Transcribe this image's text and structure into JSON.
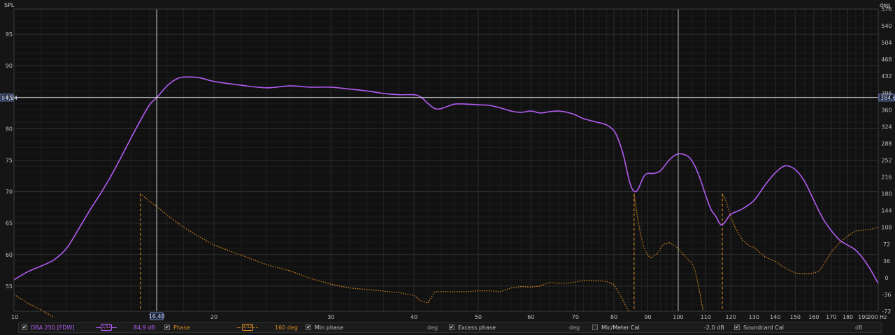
{
  "chart_data": {
    "type": "line",
    "x_scale": "log",
    "xlim": [
      10,
      200
    ],
    "ylim": [
      51,
      99
    ],
    "y2lim": [
      -72,
      576
    ],
    "ylabel": "SPL",
    "y2label": "deg",
    "x_unit_label": "Hz",
    "x_ticks": [
      {
        "value": 10,
        "label": "10"
      },
      {
        "value": 20,
        "label": "20"
      },
      {
        "value": 30,
        "label": "30"
      },
      {
        "value": 40,
        "label": "40"
      },
      {
        "value": 50,
        "label": "50"
      },
      {
        "value": 60,
        "label": "60"
      },
      {
        "value": 70,
        "label": "70"
      },
      {
        "value": 80,
        "label": "80"
      },
      {
        "value": 90,
        "label": "90"
      },
      {
        "value": 100,
        "label": "100"
      },
      {
        "value": 110,
        "label": "110"
      },
      {
        "value": 120,
        "label": "120"
      },
      {
        "value": 130,
        "label": "130"
      },
      {
        "value": 140,
        "label": "140"
      },
      {
        "value": 150,
        "label": "150"
      },
      {
        "value": 160,
        "label": "160"
      },
      {
        "value": 170,
        "label": "170"
      },
      {
        "value": 180,
        "label": "180"
      },
      {
        "value": 190,
        "label": "190"
      },
      {
        "value": 200,
        "label": "200"
      }
    ],
    "y_ticks": [
      "55",
      "60",
      "65",
      "70",
      "75",
      "80",
      "85",
      "90",
      "95"
    ],
    "y2_ticks": [
      "-72",
      "-36",
      "0",
      "36",
      "72",
      "108",
      "144",
      "180",
      "216",
      "252",
      "288",
      "324",
      "360",
      "396",
      "432",
      "468",
      "504",
      "540",
      "576"
    ],
    "grid": true,
    "cursor": {
      "x_label": "16,40",
      "y_label": "84,94",
      "y2_label": "384,6",
      "x_value": 16.4,
      "y_value": 84.94
    },
    "marker_x": 100,
    "spl_series": {
      "name": "DBA 250 [FDW]",
      "color": "#b25cf2",
      "points": [
        [
          10,
          56.0
        ],
        [
          10.5,
          57.3
        ],
        [
          11,
          58.2
        ],
        [
          11.5,
          59.2
        ],
        [
          12,
          61.0
        ],
        [
          12.5,
          64.0
        ],
        [
          13,
          67.0
        ],
        [
          13.5,
          69.7
        ],
        [
          14,
          72.5
        ],
        [
          14.5,
          75.5
        ],
        [
          15,
          78.5
        ],
        [
          15.5,
          81.3
        ],
        [
          16,
          83.8
        ],
        [
          16.4,
          84.94
        ],
        [
          17,
          86.8
        ],
        [
          17.5,
          87.8
        ],
        [
          18,
          88.2
        ],
        [
          19,
          88.1
        ],
        [
          20,
          87.5
        ],
        [
          22,
          86.9
        ],
        [
          24,
          86.5
        ],
        [
          26,
          86.8
        ],
        [
          28,
          86.6
        ],
        [
          30,
          86.6
        ],
        [
          32,
          86.3
        ],
        [
          34,
          86.0
        ],
        [
          36,
          85.6
        ],
        [
          38,
          85.4
        ],
        [
          40,
          85.4
        ],
        [
          41,
          85.0
        ],
        [
          42,
          84.0
        ],
        [
          43,
          83.2
        ],
        [
          44,
          83.2
        ],
        [
          46,
          83.9
        ],
        [
          48,
          83.9
        ],
        [
          50,
          83.8
        ],
        [
          52,
          83.7
        ],
        [
          54,
          83.3
        ],
        [
          56,
          82.8
        ],
        [
          58,
          82.6
        ],
        [
          60,
          82.8
        ],
        [
          62,
          82.5
        ],
        [
          64,
          82.7
        ],
        [
          66,
          82.8
        ],
        [
          68,
          82.6
        ],
        [
          70,
          82.2
        ],
        [
          72,
          81.6
        ],
        [
          75,
          81.1
        ],
        [
          78,
          80.6
        ],
        [
          80,
          79.7
        ],
        [
          81,
          78.6
        ],
        [
          82,
          77.1
        ],
        [
          83,
          75.1
        ],
        [
          84,
          72.6
        ],
        [
          85,
          70.7
        ],
        [
          86,
          70.0
        ],
        [
          87,
          70.4
        ],
        [
          88,
          71.6
        ],
        [
          89,
          72.6
        ],
        [
          90,
          72.9
        ],
        [
          92,
          72.9
        ],
        [
          94,
          73.3
        ],
        [
          96,
          74.5
        ],
        [
          98,
          75.5
        ],
        [
          100,
          76.0
        ],
        [
          102,
          75.9
        ],
        [
          104,
          75.4
        ],
        [
          106,
          74.0
        ],
        [
          108,
          71.9
        ],
        [
          110,
          69.4
        ],
        [
          112,
          67.2
        ],
        [
          114,
          66.0
        ],
        [
          116,
          64.7
        ],
        [
          118,
          65.4
        ],
        [
          120,
          66.4
        ],
        [
          125,
          67.3
        ],
        [
          130,
          68.6
        ],
        [
          135,
          71.0
        ],
        [
          140,
          73.0
        ],
        [
          145,
          74.1
        ],
        [
          150,
          73.5
        ],
        [
          155,
          71.6
        ],
        [
          160,
          68.6
        ],
        [
          165,
          65.8
        ],
        [
          170,
          63.8
        ],
        [
          175,
          62.3
        ],
        [
          180,
          61.5
        ],
        [
          185,
          60.7
        ],
        [
          190,
          59.3
        ],
        [
          195,
          57.5
        ],
        [
          200,
          55.4
        ]
      ]
    },
    "phase_series": {
      "name": "Phase",
      "color": "#d98a1e",
      "segments": [
        [
          [
            10,
            -36
          ],
          [
            10.5,
            -55
          ],
          [
            11,
            -70
          ],
          [
            11.5,
            -85
          ]
        ],
        [
          [
            15.5,
            180
          ],
          [
            16,
            164
          ],
          [
            16.5,
            150
          ],
          [
            17,
            134
          ],
          [
            18,
            108
          ],
          [
            19,
            88
          ],
          [
            20,
            70
          ],
          [
            22,
            48
          ],
          [
            24,
            28
          ],
          [
            26,
            15
          ],
          [
            28,
            -2
          ],
          [
            30,
            -14
          ],
          [
            32,
            -22
          ],
          [
            35,
            -27
          ],
          [
            38,
            -32
          ],
          [
            40,
            -38
          ],
          [
            41,
            -50
          ],
          [
            42,
            -54
          ],
          [
            43,
            -30
          ],
          [
            45,
            -30
          ],
          [
            48,
            -30
          ],
          [
            50,
            -28
          ],
          [
            52,
            -28
          ],
          [
            54,
            -30
          ],
          [
            56,
            -22
          ],
          [
            58,
            -19
          ],
          [
            60,
            -20
          ],
          [
            62,
            -18
          ],
          [
            64,
            -10
          ],
          [
            66,
            -12
          ],
          [
            68,
            -12
          ],
          [
            70,
            -9
          ],
          [
            72,
            -6
          ],
          [
            75,
            -6
          ],
          [
            78,
            -8
          ],
          [
            80,
            -15
          ],
          [
            82,
            -40
          ],
          [
            84,
            -70
          ],
          [
            85,
            -72
          ]
        ],
        [
          [
            85.8,
            180
          ],
          [
            87,
            120
          ],
          [
            88,
            85
          ],
          [
            89,
            60
          ],
          [
            90,
            48
          ],
          [
            91,
            42
          ],
          [
            93,
            52
          ],
          [
            95,
            72
          ],
          [
            97,
            75
          ],
          [
            99,
            68
          ],
          [
            101,
            55
          ],
          [
            103,
            42
          ],
          [
            105,
            30
          ],
          [
            106,
            15
          ],
          [
            107,
            -10
          ],
          [
            108,
            -40
          ],
          [
            109,
            -72
          ]
        ],
        [
          [
            116.5,
            180
          ],
          [
            118,
            165
          ],
          [
            120,
            130
          ],
          [
            122,
            105
          ],
          [
            125,
            80
          ],
          [
            128,
            68
          ],
          [
            130,
            65
          ],
          [
            135,
            45
          ],
          [
            140,
            35
          ],
          [
            145,
            20
          ],
          [
            150,
            10
          ],
          [
            155,
            8
          ],
          [
            160,
            10
          ],
          [
            163,
            14
          ],
          [
            165,
            25
          ],
          [
            170,
            55
          ],
          [
            175,
            75
          ],
          [
            180,
            90
          ],
          [
            185,
            100
          ],
          [
            190,
            102
          ],
          [
            195,
            104
          ],
          [
            200,
            108
          ]
        ]
      ],
      "wrap_x": [
        15.5,
        85.8,
        116.5
      ]
    }
  },
  "legend": {
    "series1": {
      "name": "DBA 250 [FDW]",
      "value": "84,9 dB",
      "smoothing": "1/12",
      "color": "#b25cf2",
      "checked": true
    },
    "phase": {
      "name": "Phase",
      "value": "160 deg",
      "smoothing": "1/12",
      "color": "#d98a1e",
      "checked": true
    },
    "min_phase": {
      "name": "Min phase",
      "unit": "deg",
      "checked": true
    },
    "excess_phase": {
      "name": "Excess phase",
      "unit": "deg",
      "checked": true
    },
    "mic_cal": {
      "name": "Mic/Meter Cal",
      "value": "-2,0 dB",
      "checked": false
    },
    "soundcard_cal": {
      "name": "Soundcard Cal",
      "unit": "dB",
      "checked": true
    }
  }
}
